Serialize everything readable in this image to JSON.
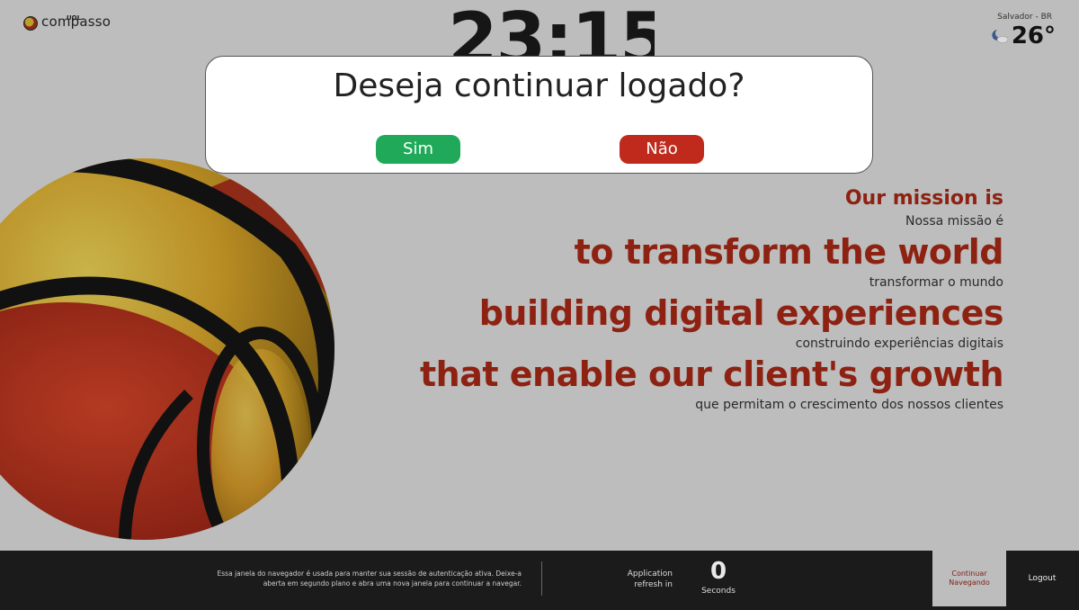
{
  "logo": {
    "name": "compasso",
    "sub": "UOL"
  },
  "clock": {
    "time": "23:15"
  },
  "weather": {
    "city": "Salvador - BR",
    "temp": "26°",
    "icon": "moon-cloud-icon"
  },
  "mission": {
    "head": "Our mission is",
    "head_pt": "Nossa missão é",
    "line1": "to transform the world",
    "line1_pt": "transformar o mundo",
    "line2": "building digital experiences",
    "line2_pt": "construindo experiências digitais",
    "line3": "that enable our client's growth",
    "line3_pt": "que permitam o crescimento dos nossos clientes"
  },
  "modal": {
    "title": "Deseja continuar logado?",
    "yes_label": "Sim",
    "no_label": "Não"
  },
  "footer": {
    "note": "Essa janela do navegador é usada para manter sua sessão de autenticação ativa. Deixe-a aberta em segundo plano e abra uma nova janela para continuar a navegar.",
    "app_refresh": "Application refresh in",
    "count": "0",
    "seconds": "Seconds",
    "continue_label": "Continuar Navegando",
    "logout_label": "Logout"
  },
  "colors": {
    "brand_red": "#8e2212",
    "yes": "#1fa959",
    "no": "#bf2a1c"
  }
}
